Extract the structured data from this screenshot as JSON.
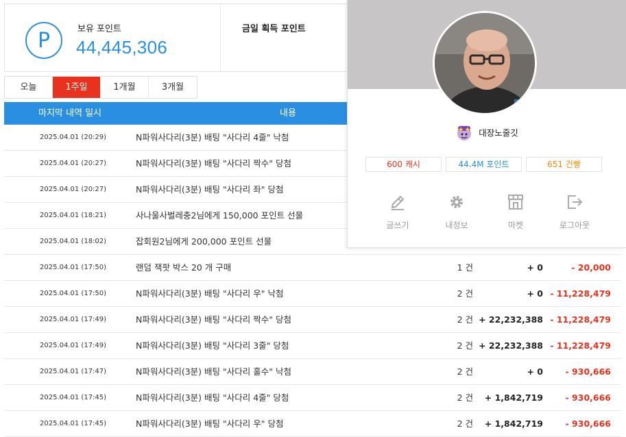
{
  "summary": {
    "hold_label": "보유 포인트",
    "hold_value": "44,445,306",
    "p_symbol": "P",
    "today_label": "금일 획득 포인트"
  },
  "tabs": [
    {
      "label": "오늘",
      "active": false
    },
    {
      "label": "1주일",
      "active": true
    },
    {
      "label": "1개월",
      "active": false
    },
    {
      "label": "3개월",
      "active": false
    }
  ],
  "table": {
    "headers": {
      "date": "마지막 내역 일시",
      "desc": "내용"
    },
    "rows": [
      {
        "date": "2025.04.01 (20:29)",
        "desc": "N파워사다리(3분) 배팅 \"사다리 4줄\" 낙첨",
        "count": "",
        "in": "",
        "out": ""
      },
      {
        "date": "2025.04.01 (20:27)",
        "desc": "N파워사다리(3분) 배팅 \"사다리 짝수\" 당첨",
        "count": "",
        "in": "",
        "out": ""
      },
      {
        "date": "2025.04.01 (20:27)",
        "desc": "N파워사다리(3분) 배팅 \"사다리 좌\" 당첨",
        "count": "",
        "in": "",
        "out": ""
      },
      {
        "date": "2025.04.01 (18:21)",
        "desc": "사나울사벌레충2님에게 150,000 포인트 선물",
        "count": "",
        "in": "",
        "out": ""
      },
      {
        "date": "2025.04.01 (18:02)",
        "desc": "잡회원2님에게 200,000 포인트 선물",
        "count": "",
        "in": "",
        "out": ""
      },
      {
        "date": "2025.04.01 (17:50)",
        "desc": "랜덤 잭팟 박스 20 개 구매",
        "count": "1 건",
        "in": "+ 0",
        "out": "- 20,000"
      },
      {
        "date": "2025.04.01 (17:50)",
        "desc": "N파워사다리(3분) 배팅 \"사다리 우\" 낙첨",
        "count": "2 건",
        "in": "+ 0",
        "out": "- 11,228,479"
      },
      {
        "date": "2025.04.01 (17:49)",
        "desc": "N파워사다리(3분) 배팅 \"사다리 짝수\" 당첨",
        "count": "2 건",
        "in": "+ 22,232,388",
        "out": "- 11,228,479"
      },
      {
        "date": "2025.04.01 (17:49)",
        "desc": "N파워사다리(3분) 배팅 \"사다리 3줄\" 당첨",
        "count": "2 건",
        "in": "+ 22,232,388",
        "out": "- 11,228,479"
      },
      {
        "date": "2025.04.01 (17:47)",
        "desc": "N파워사다리(3분) 배팅 \"사다리 홀수\" 낙첨",
        "count": "2 건",
        "in": "+ 0",
        "out": "- 930,666"
      },
      {
        "date": "2025.04.01 (17:45)",
        "desc": "N파워사다리(3분) 배팅 \"사다리 4줄\" 당첨",
        "count": "2 건",
        "in": "+ 1,842,719",
        "out": "- 930,666"
      },
      {
        "date": "2025.04.01 (17:45)",
        "desc": "N파워사다리(3분) 배팅 \"사다리 우\" 당첨",
        "count": "2 건",
        "in": "+ 1,842,719",
        "out": "- 930,666"
      }
    ]
  },
  "profile": {
    "nickname": "대장노줄깃",
    "stats": {
      "cash": "600 캐시",
      "point": "44.4M 포인트",
      "gun": "651 건빵"
    },
    "actions": [
      {
        "label": "글쓰기",
        "icon": "pencil-icon"
      },
      {
        "label": "내정보",
        "icon": "gear-icon"
      },
      {
        "label": "마켓",
        "icon": "store-icon"
      },
      {
        "label": "로그아웃",
        "icon": "logout-icon"
      }
    ]
  },
  "colors": {
    "accent": "#2a8fe0",
    "active_tab": "#e9321e",
    "negative": "#e9321e",
    "cash": "#e9321e",
    "gun": "#f08a00"
  }
}
